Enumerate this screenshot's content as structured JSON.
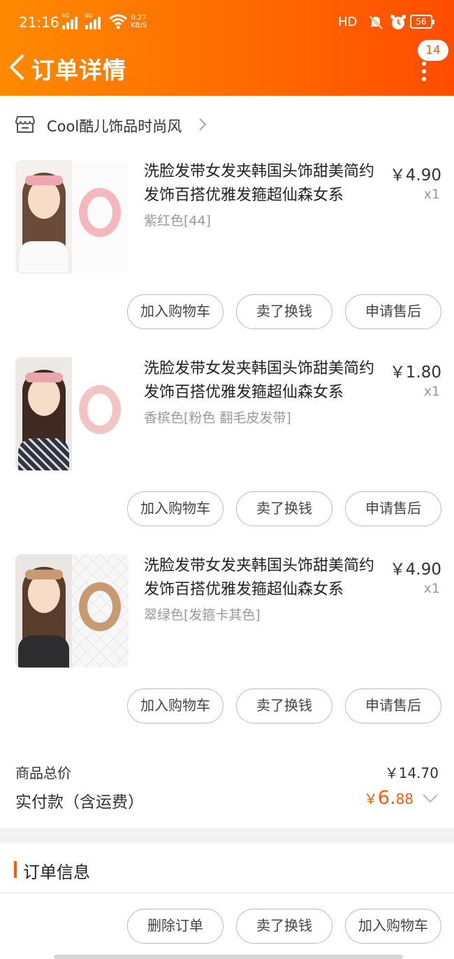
{
  "status_bar": {
    "time": "21:16",
    "signal_label": "4G",
    "net_speed": "0.27",
    "net_unit": "KB/S",
    "hd_label": "HD",
    "battery": "56"
  },
  "header": {
    "title": "订单详情",
    "badge_count": "14",
    "colors": {
      "start": "#ff8a00",
      "end": "#ff4d00"
    }
  },
  "shop": {
    "name": "Cool酷儿饰品时尚风"
  },
  "items": [
    {
      "title": "洗脸发带女发夹韩国头饰甜美简约发饰百搭优雅发箍超仙森女系",
      "spec": "紫红色[44]",
      "price": "￥4.90",
      "qty": "x1",
      "buttons": {
        "add_cart": "加入购物车",
        "sell": "卖了换钱",
        "after_sale": "申请售后"
      }
    },
    {
      "title": "洗脸发带女发夹韩国头饰甜美简约发饰百搭优雅发箍超仙森女系",
      "spec": "香槟色[粉色 翻毛皮发带]",
      "price": "￥1.80",
      "qty": "x1",
      "buttons": {
        "add_cart": "加入购物车",
        "sell": "卖了换钱",
        "after_sale": "申请售后"
      }
    },
    {
      "title": "洗脸发带女发夹韩国头饰甜美简约发饰百搭优雅发箍超仙森女系",
      "spec": "翠绿色[发箍卡其色]",
      "price": "￥4.90",
      "qty": "x1",
      "buttons": {
        "add_cart": "加入购物车",
        "sell": "卖了换钱",
        "after_sale": "申请售后"
      }
    }
  ],
  "totals": {
    "goods_total_label": "商品总价",
    "goods_total_value": "￥14.70",
    "paid_label": "实付款（含运费）",
    "paid_currency": "￥",
    "paid_int": "6.",
    "paid_dec": "88",
    "accent": "#ff5a00"
  },
  "order_info": {
    "title": "订单信息"
  },
  "bottom_actions": {
    "delete": "删除订单",
    "sell": "卖了换钱",
    "add_cart": "加入购物车"
  }
}
